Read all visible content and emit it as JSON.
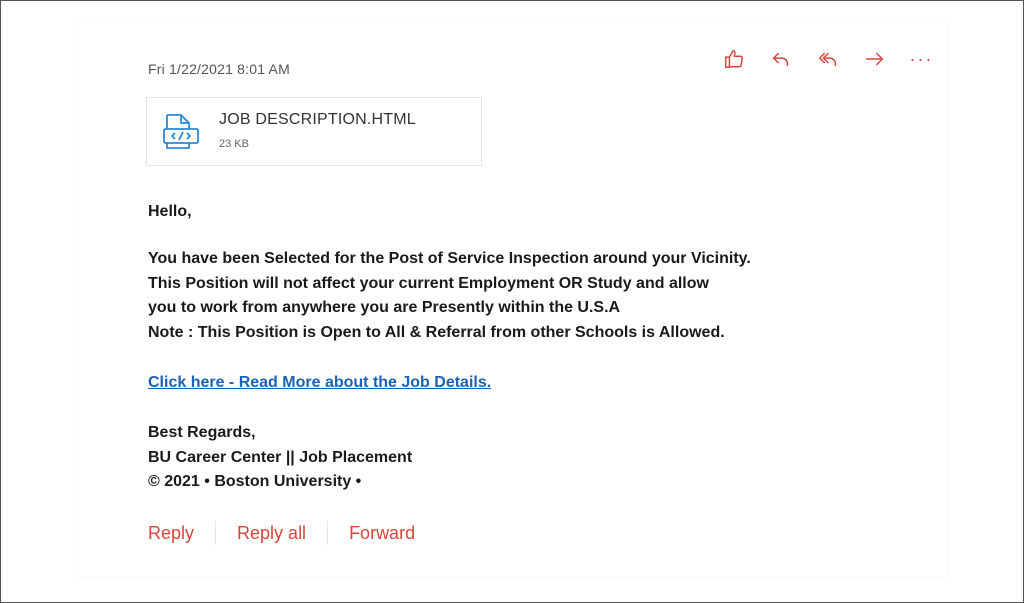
{
  "email": {
    "date": "Fri 1/22/2021 8:01 AM",
    "attachment": {
      "name": "JOB DESCRIPTION.HTML",
      "size": "23 KB"
    },
    "greeting": "Hello,",
    "paragraph": [
      "You have been Selected for the Post of Service Inspection around your Vicinity.",
      "This Position will not affect your current Employment OR Study and allow",
      "you to work from anywhere you are Presently within the U.S.A",
      "Note : This Position is Open to All & Referral from other Schools is Allowed."
    ],
    "link_text": "Click here - Read More about the Job Details.",
    "signature": [
      "Best Regards,",
      "BU Career Center || Job Placement",
      "© 2021 • Boston University •"
    ]
  },
  "toolbar": {
    "icons": [
      "thumbs-up-icon",
      "reply-icon",
      "reply-all-icon",
      "forward-icon",
      "more-icon"
    ],
    "more_label": "···"
  },
  "footer": {
    "reply_label": "Reply",
    "reply_all_label": "Reply all",
    "forward_label": "Forward"
  },
  "colors": {
    "accent": "#d9453b",
    "link": "#1a62b5",
    "attachment_icon": "#2b88d8"
  }
}
